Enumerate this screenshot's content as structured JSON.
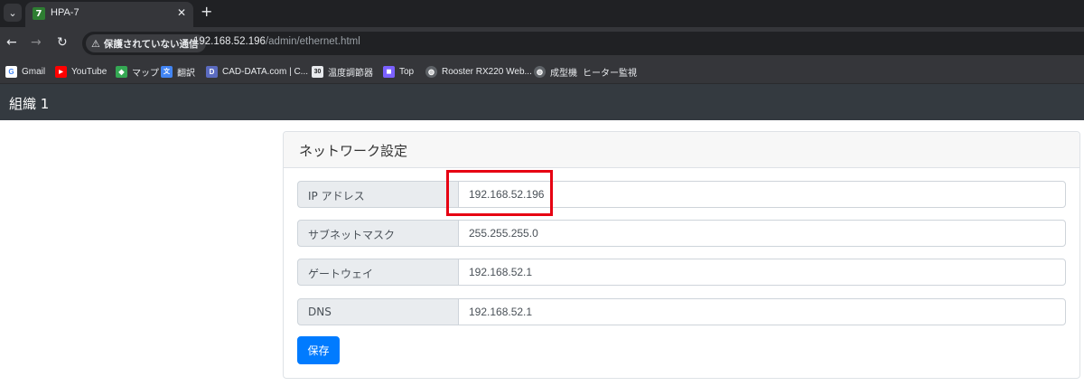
{
  "browser": {
    "tab": {
      "title": "HPA-7",
      "favicon_text": "7"
    },
    "new_tab": "+",
    "security_label": "保護されていない通信",
    "url": {
      "host": "192.168.52.196",
      "path": "/admin/ethernet.html"
    },
    "bookmarks": [
      {
        "label": "Gmail",
        "icon": "G",
        "color": "#4285f4"
      },
      {
        "label": "YouTube",
        "icon": "▶",
        "color": "#ff0000"
      },
      {
        "label": "マップ",
        "icon": "◆",
        "color": "#34a853"
      },
      {
        "label": "翻訳",
        "icon": "文",
        "color": "#4285f4"
      },
      {
        "label": "CAD-DATA.com | C...",
        "icon": "D",
        "color": "#5b6bc0"
      },
      {
        "label": "温度調節器",
        "icon": "30",
        "color": "#e8eaed"
      },
      {
        "label": "Top",
        "icon": "◼",
        "color": "#7b61ff"
      },
      {
        "label": "Rooster RX220 Web...",
        "icon": "◍",
        "color": "#9aa0a6"
      },
      {
        "label": "成型機",
        "icon": "◍",
        "color": "#9aa0a6"
      },
      {
        "label": "ヒーター監視",
        "icon": "",
        "color": ""
      }
    ]
  },
  "page": {
    "app_title": "組織 1",
    "card_title": "ネットワーク設定",
    "fields": [
      {
        "label": "IP アドレス",
        "value": "192.168.52.196"
      },
      {
        "label": "サブネットマスク",
        "value": "255.255.255.0"
      },
      {
        "label": "ゲートウェイ",
        "value": "192.168.52.1"
      },
      {
        "label": "DNS",
        "value": "192.168.52.1"
      }
    ],
    "save_label": "保存"
  },
  "colors": {
    "header_bg": "#343a40",
    "primary": "#007bff",
    "highlight": "#e60012"
  }
}
